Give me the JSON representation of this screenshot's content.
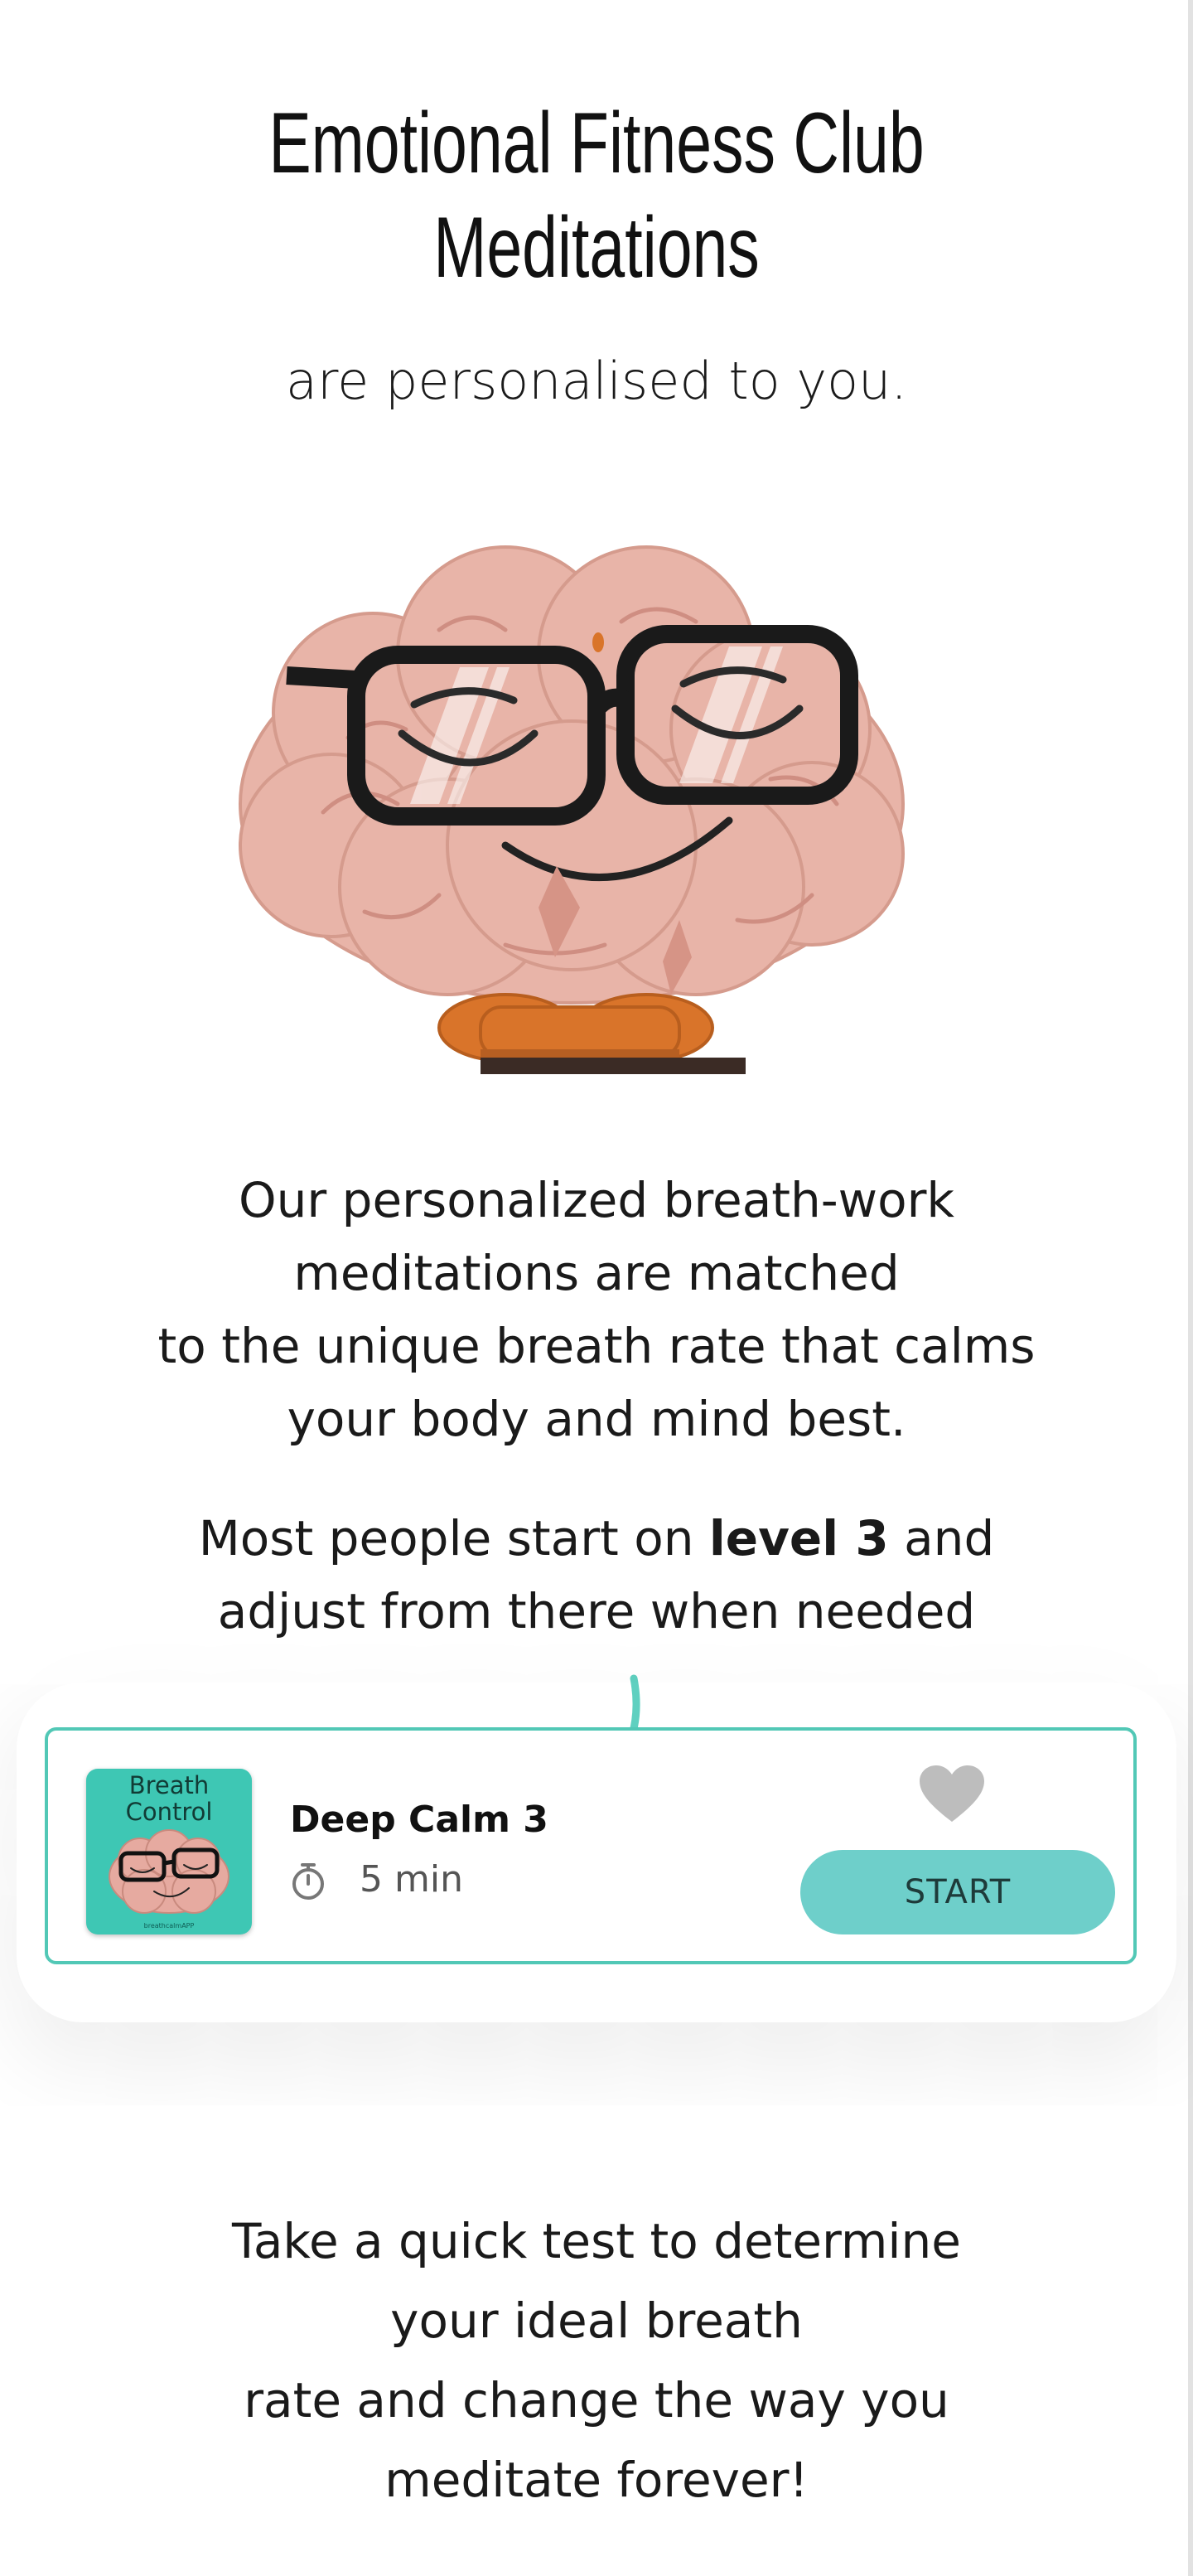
{
  "header": {
    "title_line1": "Emotional Fitness Club",
    "title_line2": "Meditations",
    "subtitle": "are personalised to you."
  },
  "intro": {
    "line1": "Our personalized breath-work",
    "line2": "meditations are matched",
    "line3": "to the unique breath rate that calms",
    "line4": "your body and mind best."
  },
  "level_note": {
    "prefix": "Most people start on ",
    "bold": "level 3",
    "suffix": " and",
    "line2": "adjust from there when needed"
  },
  "meditation_card": {
    "thumbnail_line1": "Breath",
    "thumbnail_line2": "Control",
    "thumbnail_brand": "breathcalmAPP",
    "title": "Deep Calm 3",
    "duration": "5 min",
    "start_label": "START",
    "favorited": false
  },
  "cta": {
    "line1": "Take a quick test to determine",
    "line2": "your ideal breath",
    "line3": "rate and change the way you",
    "line4": "meditate forever!"
  },
  "colors": {
    "card_border": "#52c8b6",
    "thumbnail_bg": "#3ec7b4",
    "button_bg": "#6ecfca",
    "heart": "#bdbdbd",
    "brain": "#e8b4a8",
    "cushion": "#d9742a",
    "arrow": "#5fd0c0"
  },
  "icons": {
    "timer": "stopwatch-icon",
    "favorite": "heart-icon",
    "arrow": "curved-arrow-icon"
  }
}
